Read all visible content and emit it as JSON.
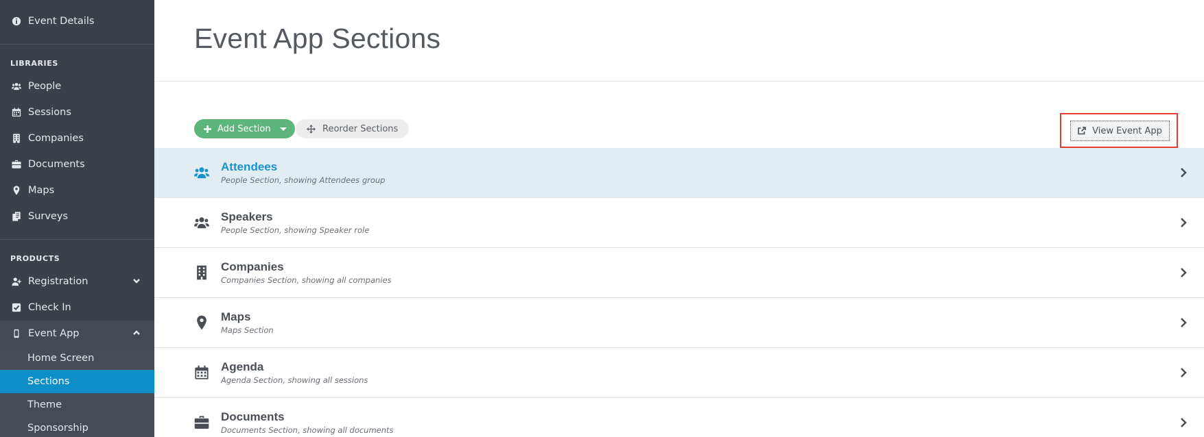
{
  "sidebar": {
    "top_item": {
      "label": "Event Details",
      "icon": "info-circle-icon"
    },
    "libraries_heading": "LIBRARIES",
    "libraries": [
      {
        "label": "People",
        "icon": "users-icon"
      },
      {
        "label": "Sessions",
        "icon": "calendar-icon"
      },
      {
        "label": "Companies",
        "icon": "building-icon"
      },
      {
        "label": "Documents",
        "icon": "briefcase-icon"
      },
      {
        "label": "Maps",
        "icon": "map-marker-icon"
      },
      {
        "label": "Surveys",
        "icon": "survey-icon"
      }
    ],
    "products_heading": "PRODUCTS",
    "products": [
      {
        "label": "Registration",
        "icon": "user-plus-icon",
        "expand": "down"
      },
      {
        "label": "Check In",
        "icon": "check-square-icon"
      },
      {
        "label": "Event App",
        "icon": "mobile-icon",
        "expand": "up"
      }
    ],
    "event_app_subitems": [
      {
        "label": "Home Screen",
        "active": false
      },
      {
        "label": "Sections",
        "active": true
      },
      {
        "label": "Theme",
        "active": false
      },
      {
        "label": "Sponsorship",
        "active": false
      }
    ]
  },
  "main": {
    "title": "Event App Sections",
    "toolbar": {
      "add_label": "Add Section",
      "reorder_label": "Reorder Sections",
      "view_label": "View Event App"
    },
    "sections": [
      {
        "title": "Attendees",
        "subtitle": "People Section, showing Attendees group",
        "icon": "users-icon",
        "highlighted": true
      },
      {
        "title": "Speakers",
        "subtitle": "People Section, showing Speaker role",
        "icon": "users-icon",
        "highlighted": false
      },
      {
        "title": "Companies",
        "subtitle": "Companies Section, showing all companies",
        "icon": "building-icon",
        "highlighted": false
      },
      {
        "title": "Maps",
        "subtitle": "Maps Section",
        "icon": "map-marker-icon",
        "highlighted": false
      },
      {
        "title": "Agenda",
        "subtitle": "Agenda Section, showing all sessions",
        "icon": "calendar-icon",
        "highlighted": false
      },
      {
        "title": "Documents",
        "subtitle": "Documents Section, showing all documents",
        "icon": "briefcase-icon",
        "highlighted": false
      }
    ]
  },
  "colors": {
    "sidebar_bg": "#3b4149",
    "active_item": "#0e8ec9",
    "add_button": "#5cb67b",
    "highlight_row": "#e2ecf3",
    "highlight_text": "#1b92c9",
    "focus_frame": "#e53b2c"
  }
}
